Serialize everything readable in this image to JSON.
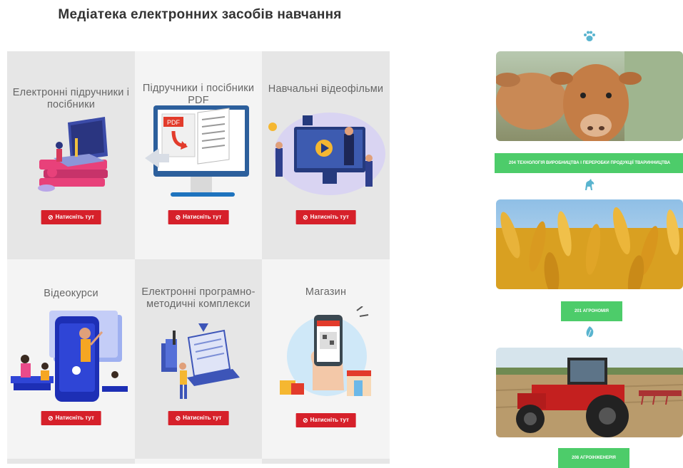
{
  "page": {
    "title": "Медіатека електронних засобів навчання"
  },
  "tiles": [
    {
      "title": "Електронні підручники і посібники",
      "button": "Натисніть тут"
    },
    {
      "title": "Підручники і посібники PDF",
      "button": "Натисніть тут",
      "pdf_label": "PDF"
    },
    {
      "title": "Навчальні відеофільми",
      "button": "Натисніть тут"
    },
    {
      "title": "Відеокурси",
      "button": "Натисніть тут"
    },
    {
      "title": "Електронні програмно-методичні комплекси",
      "button": "Натисніть тут"
    },
    {
      "title": "Магазин",
      "button": "Натисніть тут"
    }
  ],
  "specialties": [
    {
      "icon": "paw-icon",
      "label": "204 ТЕХНОЛОГІЯ ВИРОБНИЦТВА І ПЕРЕРОБКИ ПРОДУКЦІЇ ТВАРИННИЦТВА"
    },
    {
      "icon": "horse-icon",
      "label": "201 АГРОНОМІЯ"
    },
    {
      "icon": "leaf-icon",
      "label": "208 АГРОІНЖЕНЕРІЯ"
    }
  ],
  "colors": {
    "button_red": "#d6202a",
    "spec_green": "#4dcc6a",
    "icon_blue": "#59b4cf"
  }
}
